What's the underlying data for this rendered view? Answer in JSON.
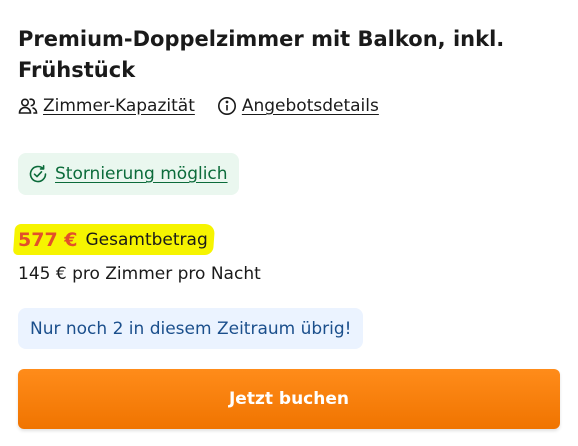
{
  "room": {
    "title": "Premium-Doppelzimmer mit Balkon, inkl. Frühstück"
  },
  "links": {
    "capacity_label": "Zimmer-Kapazität",
    "details_label": "Angebotsdetails",
    "capacity_icon": "people-icon",
    "details_icon": "info-icon"
  },
  "cancellation": {
    "label": "Stornierung möglich",
    "icon": "clock-check-icon",
    "color": "#0b6b3a",
    "background": "#eaf7ef"
  },
  "price": {
    "total": "577 €",
    "total_label": "Gesamtbetrag",
    "per_night": "145 € pro Zimmer pro Nacht",
    "total_color": "#e2502a",
    "highlight_color": "#f6f400"
  },
  "availability": {
    "message": "Nur noch 2 in diesem Zeitraum übrig!",
    "color": "#1b4f8c",
    "background": "#ebf3ff"
  },
  "cta": {
    "label": "Jetzt buchen",
    "color": "#f07400"
  }
}
